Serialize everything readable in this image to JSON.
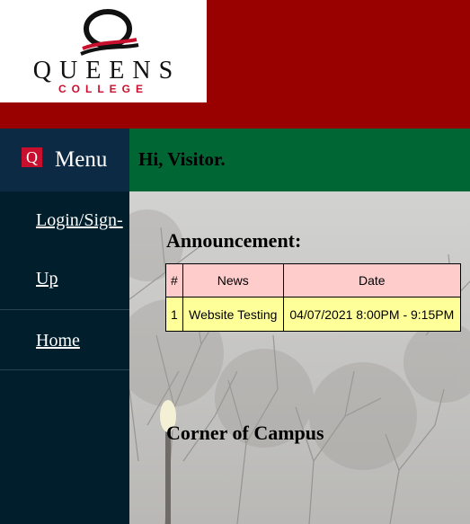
{
  "logo": {
    "wordmark": "QUEENS",
    "subtitle": "COLLEGE",
    "mark_letter": "Q"
  },
  "menu": {
    "icon_letter": "Q",
    "label": "Menu",
    "items": [
      {
        "label": "Login/Sign-Up"
      },
      {
        "label": "Home"
      }
    ]
  },
  "greeting": "Hi, Visitor.",
  "announcements": {
    "title": "Announcement:",
    "columns": [
      "#",
      "News",
      "Date"
    ],
    "rows": [
      {
        "num": "1",
        "news": "Website Testing",
        "date": "04/07/2021 8:00PM - 9:15PM"
      }
    ]
  },
  "campus_title": "Corner of Campus",
  "colors": {
    "header": "#990000",
    "greeting_bar": "#006633",
    "sidebar": "#011e2c",
    "menu_head": "#0c2a44",
    "brand_red": "#c8102e",
    "table_header": "#ffcccc",
    "table_cell": "#ffff99"
  }
}
